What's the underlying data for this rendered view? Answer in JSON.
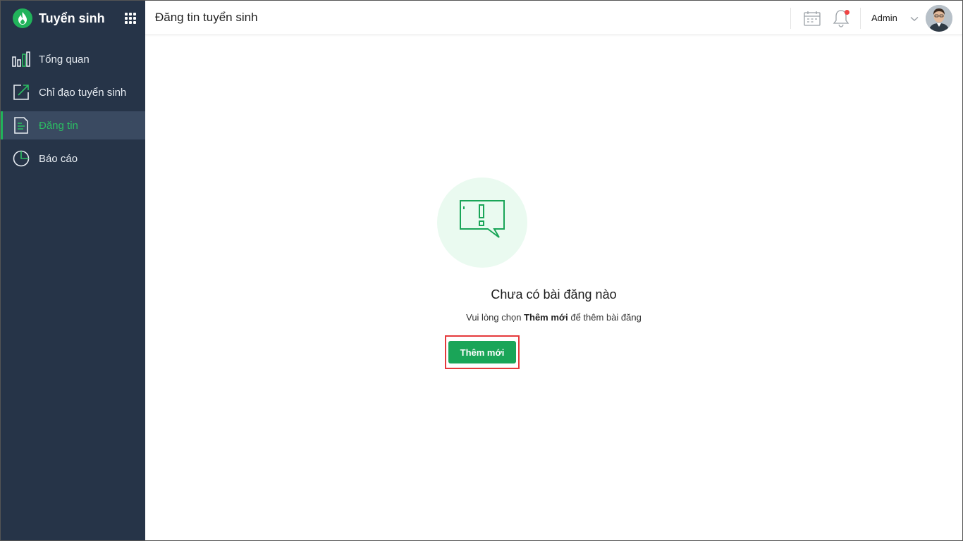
{
  "brand": {
    "title": "Tuyển sinh"
  },
  "sidebar": {
    "items": [
      {
        "label": "Tổng quan",
        "icon": "bar-chart-icon",
        "active": false
      },
      {
        "label": "Chỉ đạo tuyển sinh",
        "icon": "edit-arrow-icon",
        "active": false
      },
      {
        "label": "Đăng tin",
        "icon": "document-icon",
        "active": true
      },
      {
        "label": "Báo cáo",
        "icon": "pie-chart-icon",
        "active": false
      }
    ]
  },
  "header": {
    "page_title": "Đăng tin tuyển sinh",
    "user_name": "Admin"
  },
  "empty_state": {
    "title": "Chưa có bài đăng nào",
    "hint_before": "Vui lòng chọn ",
    "hint_bold": "Thêm mới",
    "hint_after": " để thêm bài đăng",
    "button_label": "Thêm mới"
  },
  "colors": {
    "sidebar_bg": "#263448",
    "accent_green": "#1aa558",
    "active_item_bg": "#3a4a61",
    "notification_dot": "#ef4444",
    "highlight_border": "#e5393b"
  }
}
